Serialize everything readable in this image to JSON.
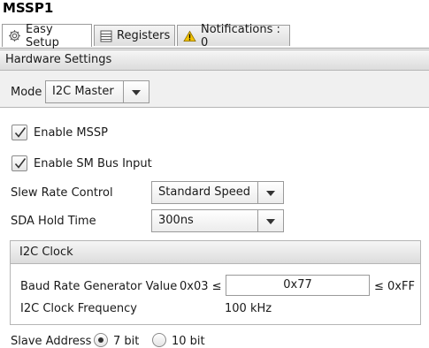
{
  "window": {
    "title": "MSSP1"
  },
  "tabs": [
    {
      "label": "Easy Setup",
      "icon": "gear-icon"
    },
    {
      "label": "Registers",
      "icon": "list-icon"
    },
    {
      "label": "Notifications : 0",
      "icon": "warning-icon"
    }
  ],
  "hardware": {
    "header": "Hardware Settings",
    "mode_label": "Mode",
    "mode_value": "I2C Master"
  },
  "options": {
    "enable_mssp": {
      "label": "Enable MSSP",
      "checked": true
    },
    "enable_smbus": {
      "label": "Enable SM Bus Input",
      "checked": true
    },
    "slew_rate": {
      "label": "Slew Rate Control",
      "value": "Standard Speed"
    },
    "sda_hold": {
      "label": "SDA Hold Time",
      "value": "300ns"
    }
  },
  "i2c_clock": {
    "header": "I2C Clock",
    "baud_label": "Baud Rate Generator Value",
    "baud_min": "0x03 ≤",
    "baud_value": "0x77",
    "baud_max": "≤ 0xFF",
    "freq_label": "I2C Clock Frequency",
    "freq_value": "100 kHz"
  },
  "slave_address": {
    "label": "Slave Address",
    "options": [
      "7 bit",
      "10 bit"
    ],
    "selected": "7 bit"
  },
  "colors": {
    "warning": "#f2c200",
    "border": "#9a9a9a"
  }
}
